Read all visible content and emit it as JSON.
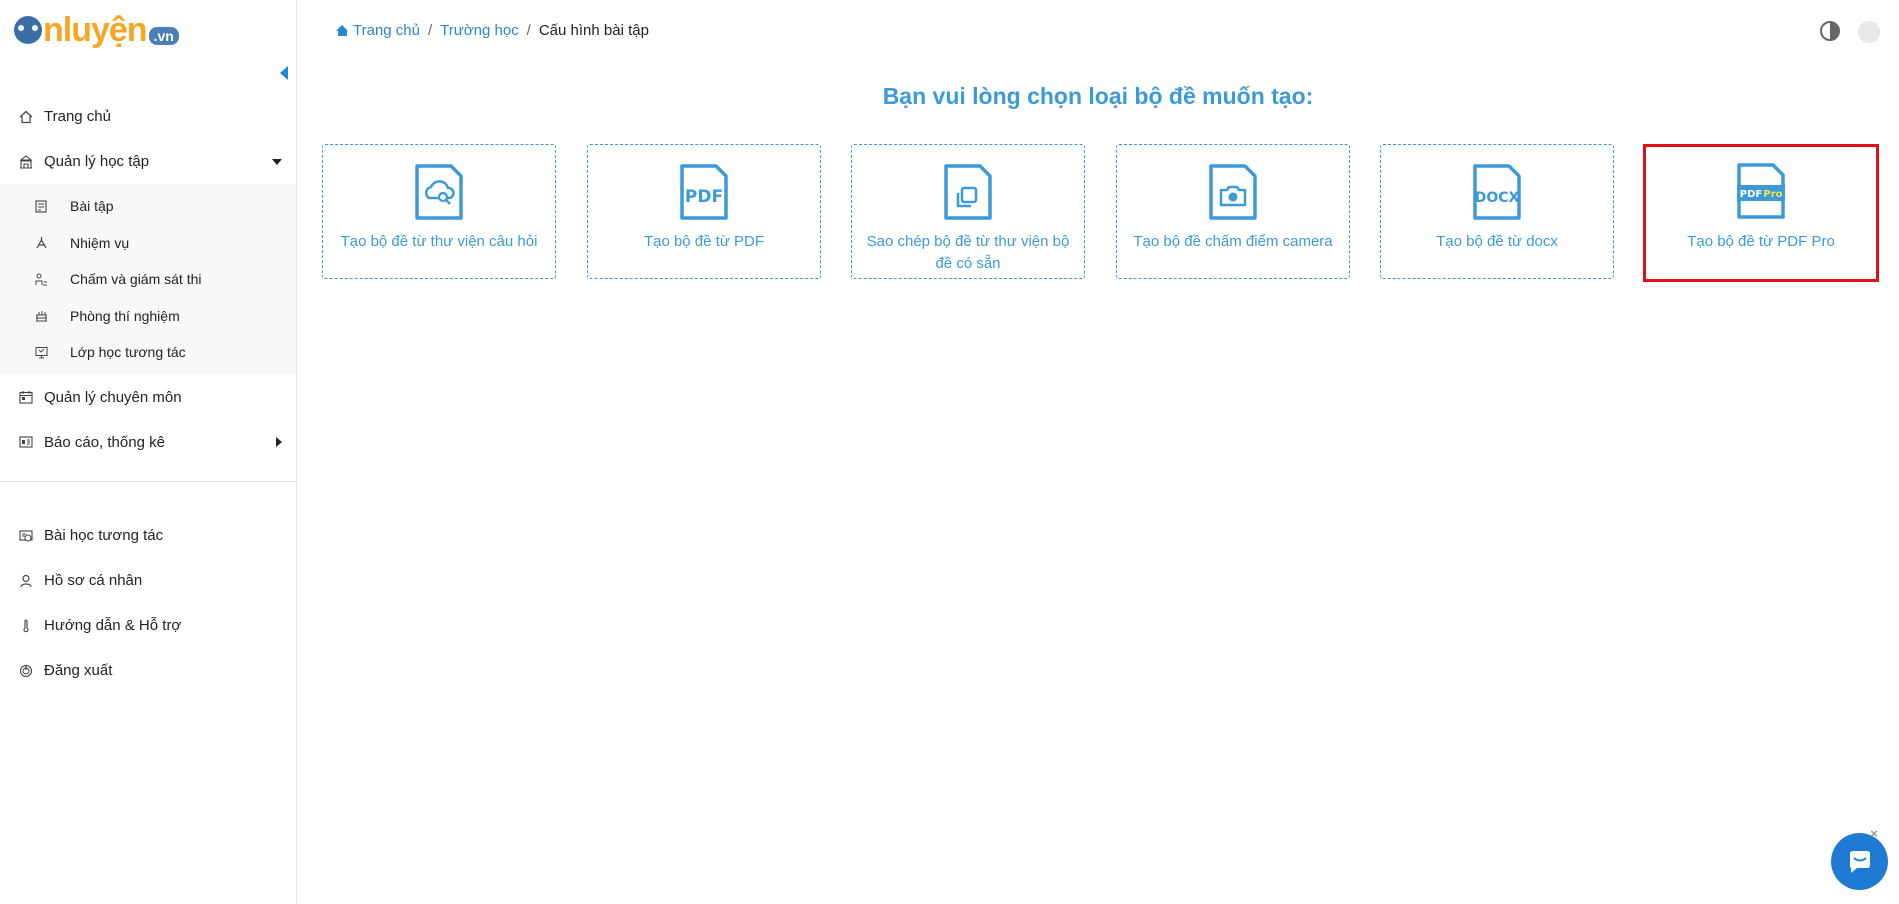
{
  "logo": {
    "text": "nluyện",
    "suffix": ".vn"
  },
  "sidebar": {
    "items": [
      {
        "label": "Trang chủ"
      },
      {
        "label": "Quản lý học tập"
      },
      {
        "label": "Quản lý chuyên môn"
      },
      {
        "label": "Báo cáo, thống kê"
      }
    ],
    "sub_items": [
      {
        "label": "Bài tập"
      },
      {
        "label": "Nhiệm vụ"
      },
      {
        "label": "Chấm và giám sát thi"
      },
      {
        "label": "Phòng thí nghiệm"
      },
      {
        "label": "Lớp học tương tác"
      }
    ],
    "bottom_items": [
      {
        "label": "Bài học tương tác"
      },
      {
        "label": "Hồ sơ cá nhân"
      },
      {
        "label": "Hướng dẫn & Hỗ trợ"
      },
      {
        "label": "Đăng xuất"
      }
    ]
  },
  "breadcrumb": {
    "home": "Trang chủ",
    "level1": "Trường học",
    "current": "Cấu hình bài tập",
    "separator": "/"
  },
  "main": {
    "heading": "Bạn vui lòng chọn loại bộ đề muốn tạo:",
    "cards": [
      {
        "label": "Tạo bộ đề từ thư viện câu hỏi",
        "icon": "cloud-search-doc-icon"
      },
      {
        "label": "Tạo bộ đề từ PDF",
        "icon": "pdf-doc-icon",
        "badge": "PDF"
      },
      {
        "label": "Sao chép bộ đề từ thư viện bộ đề có sẵn",
        "icon": "copy-doc-icon"
      },
      {
        "label": "Tạo bộ đề chấm điểm camera",
        "icon": "camera-doc-icon"
      },
      {
        "label": "Tạo bộ đề từ docx",
        "icon": "docx-doc-icon",
        "badge": "DOCX"
      },
      {
        "label": "Tạo bộ đề từ PDF Pro",
        "icon": "pdf-pro-doc-icon",
        "badge": "PDF",
        "badge2": "Pro"
      }
    ]
  },
  "colors": {
    "accent": "#3d9ad9",
    "selected_border": "#e00f1c",
    "chat": "#1f7ad4"
  }
}
